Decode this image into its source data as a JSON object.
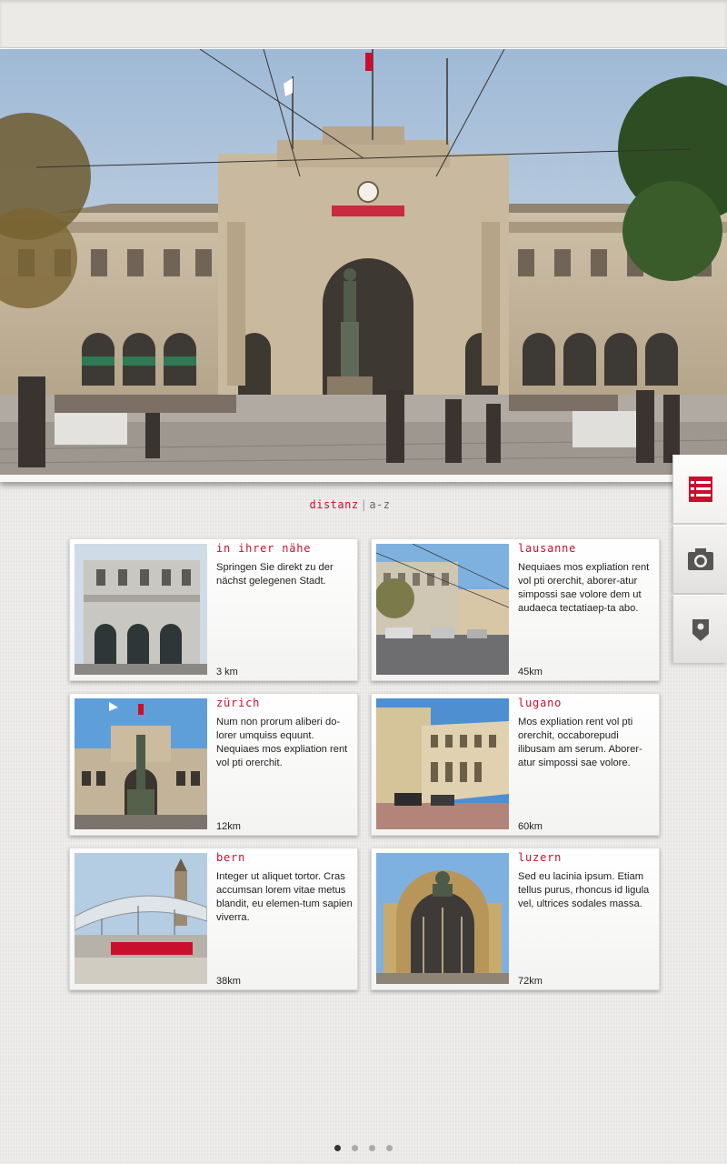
{
  "sort": {
    "active_label": "distanz",
    "separator": "|",
    "inactive_label": "a-z"
  },
  "side_nav": {
    "items": [
      {
        "icon": "list-icon",
        "active": true,
        "color": "#c8102e"
      },
      {
        "icon": "camera-icon",
        "active": false,
        "color": "#555555"
      },
      {
        "icon": "map-pin-icon",
        "active": false,
        "color": "#555555"
      }
    ]
  },
  "cards": [
    {
      "title": "in ihrer nähe",
      "description": "Springen Sie direkt zu der nächst gelegenen Stadt.",
      "distance": "3 km"
    },
    {
      "title": "lausanne",
      "description": "Nequiaes mos expliation rent vol pti orerchit, aborer-atur simpossi sae volore dem ut audaeca tectatiaep-ta abo.",
      "distance": "45km"
    },
    {
      "title": "zürich",
      "description": "Num non prorum aliberi do-lorer umquiss equunt. Nequiaes mos expliation rent vol pti orerchit.",
      "distance": "12km"
    },
    {
      "title": "lugano",
      "description": "Mos expliation rent vol pti orerchit, occaborepudi ilibusam am serum. Aborer-atur simpossi sae volore.",
      "distance": "60km"
    },
    {
      "title": "bern",
      "description": "Integer ut aliquet tortor. Cras accumsan lorem vitae metus blandit, eu elemen-tum sapien viverra.",
      "distance": "38km"
    },
    {
      "title": "luzern",
      "description": "Sed eu lacinia ipsum. Etiam tellus purus, rhoncus id ligula vel, ultrices sodales massa.",
      "distance": "72km"
    }
  ],
  "pager": {
    "pages": 4,
    "current": 1
  },
  "colors": {
    "accent": "#c8102e",
    "background": "#ebeae8"
  }
}
